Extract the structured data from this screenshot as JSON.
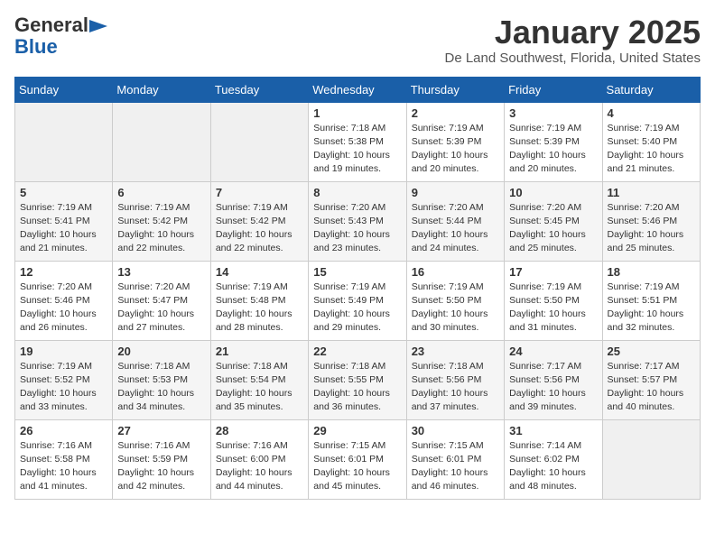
{
  "header": {
    "logo_general": "General",
    "logo_blue": "Blue",
    "title": "January 2025",
    "subtitle": "De Land Southwest, Florida, United States"
  },
  "weekdays": [
    "Sunday",
    "Monday",
    "Tuesday",
    "Wednesday",
    "Thursday",
    "Friday",
    "Saturday"
  ],
  "weeks": [
    [
      {
        "day": "",
        "sunrise": "",
        "sunset": "",
        "daylight": "",
        "empty": true
      },
      {
        "day": "",
        "sunrise": "",
        "sunset": "",
        "daylight": "",
        "empty": true
      },
      {
        "day": "",
        "sunrise": "",
        "sunset": "",
        "daylight": "",
        "empty": true
      },
      {
        "day": "1",
        "sunrise": "Sunrise: 7:18 AM",
        "sunset": "Sunset: 5:38 PM",
        "daylight": "Daylight: 10 hours and 19 minutes.",
        "empty": false
      },
      {
        "day": "2",
        "sunrise": "Sunrise: 7:19 AM",
        "sunset": "Sunset: 5:39 PM",
        "daylight": "Daylight: 10 hours and 20 minutes.",
        "empty": false
      },
      {
        "day": "3",
        "sunrise": "Sunrise: 7:19 AM",
        "sunset": "Sunset: 5:39 PM",
        "daylight": "Daylight: 10 hours and 20 minutes.",
        "empty": false
      },
      {
        "day": "4",
        "sunrise": "Sunrise: 7:19 AM",
        "sunset": "Sunset: 5:40 PM",
        "daylight": "Daylight: 10 hours and 21 minutes.",
        "empty": false
      }
    ],
    [
      {
        "day": "5",
        "sunrise": "Sunrise: 7:19 AM",
        "sunset": "Sunset: 5:41 PM",
        "daylight": "Daylight: 10 hours and 21 minutes.",
        "empty": false
      },
      {
        "day": "6",
        "sunrise": "Sunrise: 7:19 AM",
        "sunset": "Sunset: 5:42 PM",
        "daylight": "Daylight: 10 hours and 22 minutes.",
        "empty": false
      },
      {
        "day": "7",
        "sunrise": "Sunrise: 7:19 AM",
        "sunset": "Sunset: 5:42 PM",
        "daylight": "Daylight: 10 hours and 22 minutes.",
        "empty": false
      },
      {
        "day": "8",
        "sunrise": "Sunrise: 7:20 AM",
        "sunset": "Sunset: 5:43 PM",
        "daylight": "Daylight: 10 hours and 23 minutes.",
        "empty": false
      },
      {
        "day": "9",
        "sunrise": "Sunrise: 7:20 AM",
        "sunset": "Sunset: 5:44 PM",
        "daylight": "Daylight: 10 hours and 24 minutes.",
        "empty": false
      },
      {
        "day": "10",
        "sunrise": "Sunrise: 7:20 AM",
        "sunset": "Sunset: 5:45 PM",
        "daylight": "Daylight: 10 hours and 25 minutes.",
        "empty": false
      },
      {
        "day": "11",
        "sunrise": "Sunrise: 7:20 AM",
        "sunset": "Sunset: 5:46 PM",
        "daylight": "Daylight: 10 hours and 25 minutes.",
        "empty": false
      }
    ],
    [
      {
        "day": "12",
        "sunrise": "Sunrise: 7:20 AM",
        "sunset": "Sunset: 5:46 PM",
        "daylight": "Daylight: 10 hours and 26 minutes.",
        "empty": false
      },
      {
        "day": "13",
        "sunrise": "Sunrise: 7:20 AM",
        "sunset": "Sunset: 5:47 PM",
        "daylight": "Daylight: 10 hours and 27 minutes.",
        "empty": false
      },
      {
        "day": "14",
        "sunrise": "Sunrise: 7:19 AM",
        "sunset": "Sunset: 5:48 PM",
        "daylight": "Daylight: 10 hours and 28 minutes.",
        "empty": false
      },
      {
        "day": "15",
        "sunrise": "Sunrise: 7:19 AM",
        "sunset": "Sunset: 5:49 PM",
        "daylight": "Daylight: 10 hours and 29 minutes.",
        "empty": false
      },
      {
        "day": "16",
        "sunrise": "Sunrise: 7:19 AM",
        "sunset": "Sunset: 5:50 PM",
        "daylight": "Daylight: 10 hours and 30 minutes.",
        "empty": false
      },
      {
        "day": "17",
        "sunrise": "Sunrise: 7:19 AM",
        "sunset": "Sunset: 5:50 PM",
        "daylight": "Daylight: 10 hours and 31 minutes.",
        "empty": false
      },
      {
        "day": "18",
        "sunrise": "Sunrise: 7:19 AM",
        "sunset": "Sunset: 5:51 PM",
        "daylight": "Daylight: 10 hours and 32 minutes.",
        "empty": false
      }
    ],
    [
      {
        "day": "19",
        "sunrise": "Sunrise: 7:19 AM",
        "sunset": "Sunset: 5:52 PM",
        "daylight": "Daylight: 10 hours and 33 minutes.",
        "empty": false
      },
      {
        "day": "20",
        "sunrise": "Sunrise: 7:18 AM",
        "sunset": "Sunset: 5:53 PM",
        "daylight": "Daylight: 10 hours and 34 minutes.",
        "empty": false
      },
      {
        "day": "21",
        "sunrise": "Sunrise: 7:18 AM",
        "sunset": "Sunset: 5:54 PM",
        "daylight": "Daylight: 10 hours and 35 minutes.",
        "empty": false
      },
      {
        "day": "22",
        "sunrise": "Sunrise: 7:18 AM",
        "sunset": "Sunset: 5:55 PM",
        "daylight": "Daylight: 10 hours and 36 minutes.",
        "empty": false
      },
      {
        "day": "23",
        "sunrise": "Sunrise: 7:18 AM",
        "sunset": "Sunset: 5:56 PM",
        "daylight": "Daylight: 10 hours and 37 minutes.",
        "empty": false
      },
      {
        "day": "24",
        "sunrise": "Sunrise: 7:17 AM",
        "sunset": "Sunset: 5:56 PM",
        "daylight": "Daylight: 10 hours and 39 minutes.",
        "empty": false
      },
      {
        "day": "25",
        "sunrise": "Sunrise: 7:17 AM",
        "sunset": "Sunset: 5:57 PM",
        "daylight": "Daylight: 10 hours and 40 minutes.",
        "empty": false
      }
    ],
    [
      {
        "day": "26",
        "sunrise": "Sunrise: 7:16 AM",
        "sunset": "Sunset: 5:58 PM",
        "daylight": "Daylight: 10 hours and 41 minutes.",
        "empty": false
      },
      {
        "day": "27",
        "sunrise": "Sunrise: 7:16 AM",
        "sunset": "Sunset: 5:59 PM",
        "daylight": "Daylight: 10 hours and 42 minutes.",
        "empty": false
      },
      {
        "day": "28",
        "sunrise": "Sunrise: 7:16 AM",
        "sunset": "Sunset: 6:00 PM",
        "daylight": "Daylight: 10 hours and 44 minutes.",
        "empty": false
      },
      {
        "day": "29",
        "sunrise": "Sunrise: 7:15 AM",
        "sunset": "Sunset: 6:01 PM",
        "daylight": "Daylight: 10 hours and 45 minutes.",
        "empty": false
      },
      {
        "day": "30",
        "sunrise": "Sunrise: 7:15 AM",
        "sunset": "Sunset: 6:01 PM",
        "daylight": "Daylight: 10 hours and 46 minutes.",
        "empty": false
      },
      {
        "day": "31",
        "sunrise": "Sunrise: 7:14 AM",
        "sunset": "Sunset: 6:02 PM",
        "daylight": "Daylight: 10 hours and 48 minutes.",
        "empty": false
      },
      {
        "day": "",
        "sunrise": "",
        "sunset": "",
        "daylight": "",
        "empty": true
      }
    ]
  ]
}
